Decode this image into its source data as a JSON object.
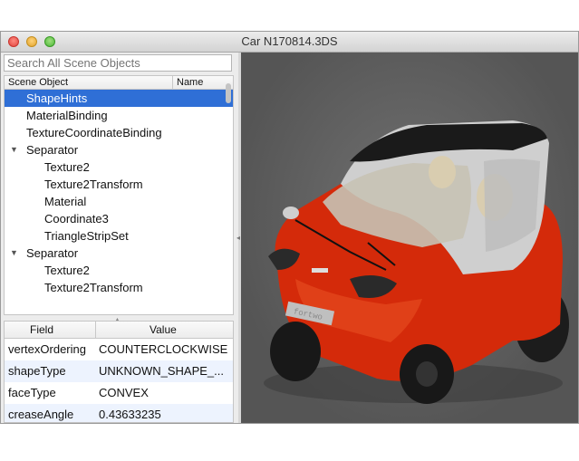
{
  "window": {
    "title": "Car N170814.3DS"
  },
  "search": {
    "placeholder": "Search All Scene Objects"
  },
  "tree": {
    "headers": {
      "scene_object": "Scene Object",
      "name": "Name"
    },
    "rows": [
      {
        "label": "ShapeHints",
        "level": 0,
        "selected": true
      },
      {
        "label": "MaterialBinding",
        "level": 0
      },
      {
        "label": "TextureCoordinateBinding",
        "level": 0
      },
      {
        "label": "Separator",
        "level": 0,
        "expanded": true
      },
      {
        "label": "Texture2",
        "level": 1
      },
      {
        "label": "Texture2Transform",
        "level": 1
      },
      {
        "label": "Material",
        "level": 1
      },
      {
        "label": "Coordinate3",
        "level": 1
      },
      {
        "label": "TriangleStripSet",
        "level": 1
      },
      {
        "label": "Separator",
        "level": 0,
        "expanded": true
      },
      {
        "label": "Texture2",
        "level": 1
      },
      {
        "label": "Texture2Transform",
        "level": 1
      }
    ]
  },
  "properties": {
    "headers": {
      "field": "Field",
      "value": "Value"
    },
    "rows": [
      {
        "field": "vertexOrdering",
        "value": "COUNTERCLOCKWISE"
      },
      {
        "field": "shapeType",
        "value": "UNKNOWN_SHAPE_..."
      },
      {
        "field": "faceType",
        "value": "CONVEX"
      },
      {
        "field": "creaseAngle",
        "value": "0.43633235"
      }
    ]
  },
  "viewport": {
    "model_text": {
      "badge": "smart",
      "plate": "fortwo"
    }
  },
  "colors": {
    "selection": "#2f6fd6",
    "car_body": "#d42a0a",
    "car_frame": "#d0d0d0",
    "viewport_bg": "#5e5e5e"
  }
}
